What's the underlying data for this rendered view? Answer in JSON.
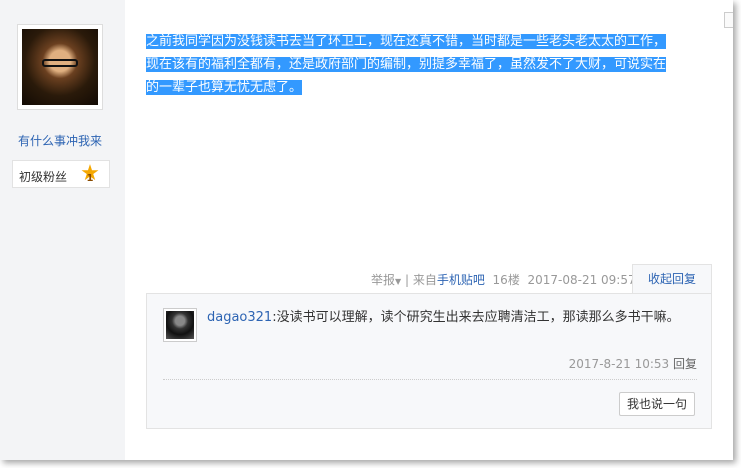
{
  "author": {
    "username": "有什么事冲我来",
    "rank_title": "初级粉丝",
    "rank_level": "1"
  },
  "post": {
    "lines": [
      "之前我同学因为没钱读书去当了环卫工，现在还真不错，当时都是一些老头老太太的工作，",
      "现在该有的福利全都有，还是政府部门的编制，别提多幸福了，虽然发不了大财，可说实在",
      "的一辈子也算无忧无虑了。"
    ],
    "report_label": "举报",
    "separator": "|",
    "source_prefix": "来自",
    "source_link": "手机贴吧",
    "floor": "16楼",
    "timestamp": "2017-08-21 09:57",
    "collapse_label": "收起回复"
  },
  "reply": {
    "username": "dagao321",
    "colon": ":",
    "text": "没读书可以理解，读个研究生出来去应聘清洁工，那读那么多书干嘛。",
    "timestamp": "2017-8-21 10:53",
    "reply_label": "回复",
    "say_button": "我也说一句"
  },
  "colors": {
    "selection": "#3399ff",
    "link": "#2d64b3",
    "sidebar_bg": "#f3f4f6",
    "reply_bg": "#f7f8fa"
  },
  "icons": {
    "rank": "star-badge-icon",
    "report": "caret-down-icon"
  }
}
